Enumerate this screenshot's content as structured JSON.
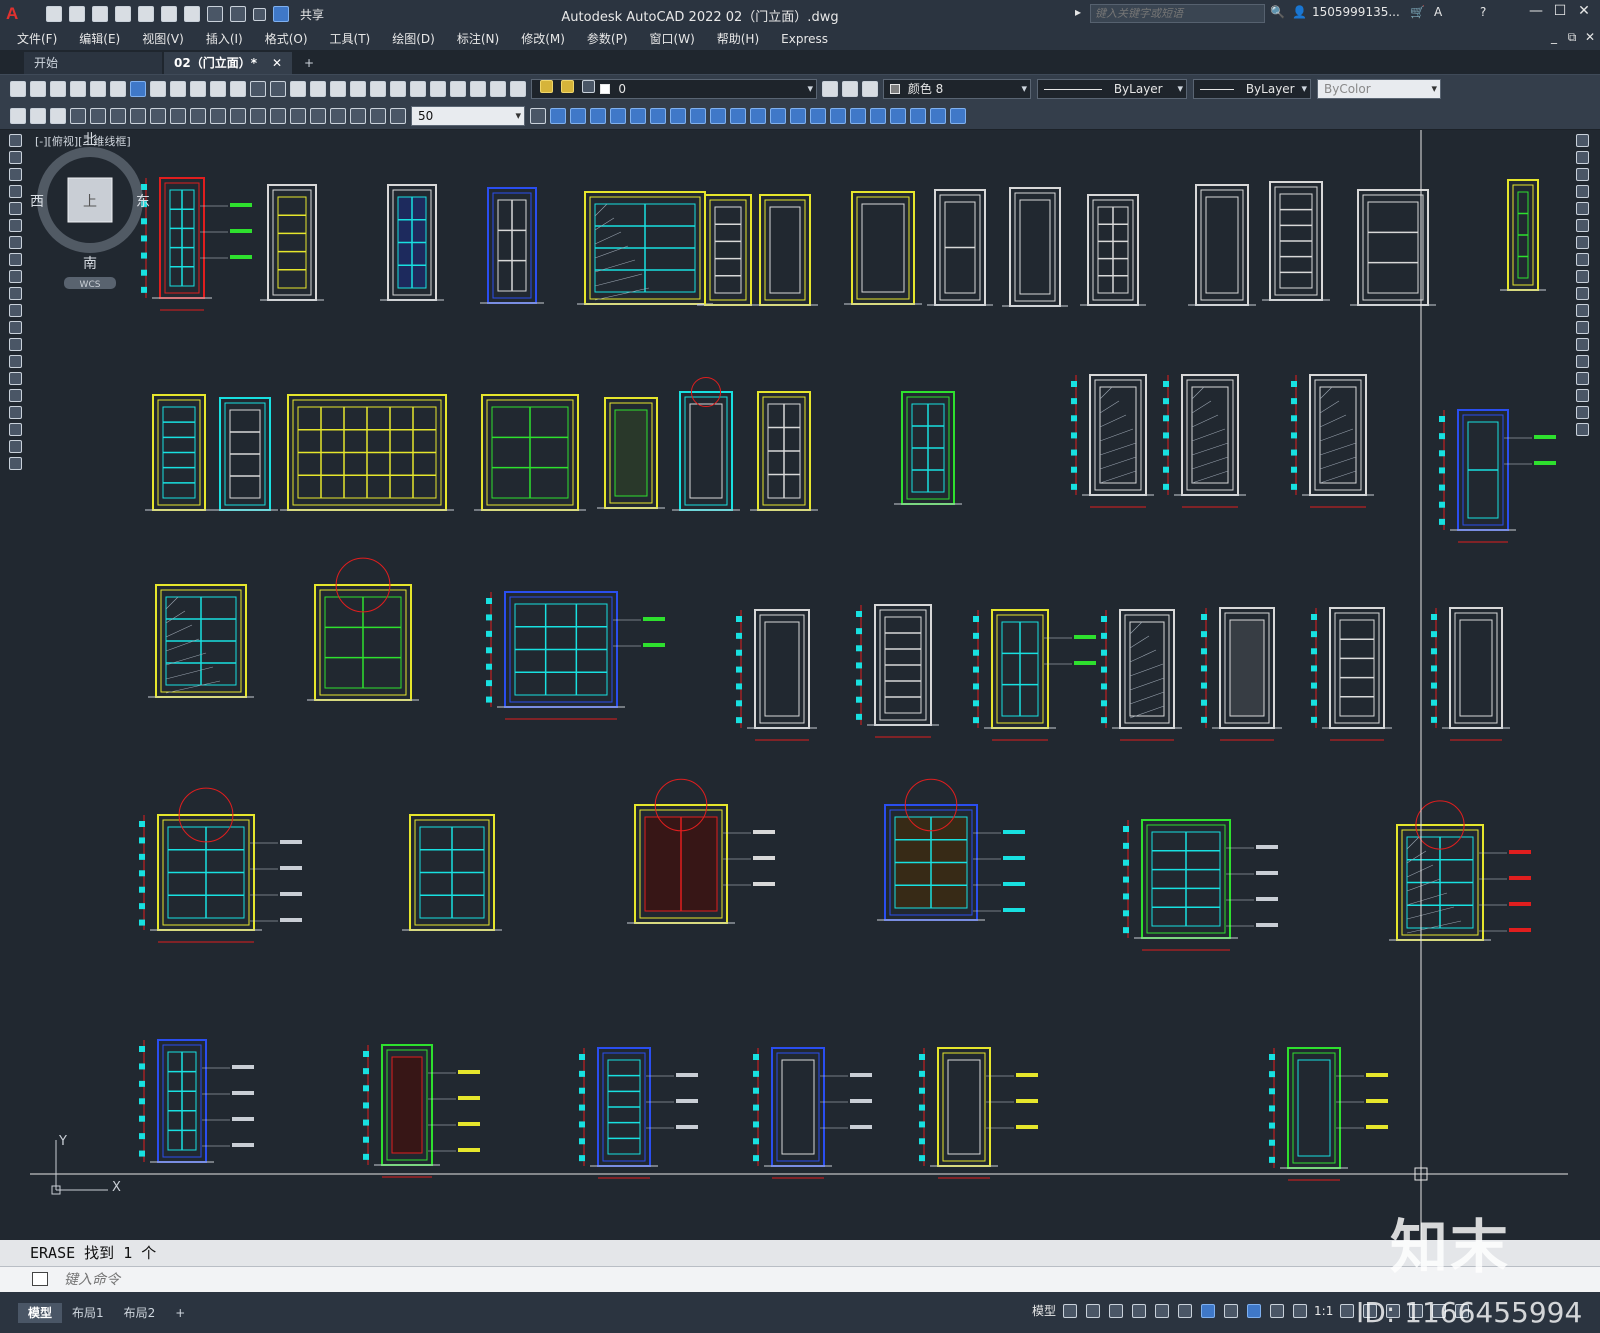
{
  "window": {
    "app_letter": "A",
    "title": "Autodesk AutoCAD 2022    02（门立面）.dwg",
    "share_label": "共享",
    "search_placeholder": "键入关键字或短语",
    "user": "1505999135...",
    "min": "—",
    "max": "☐",
    "close": "✕",
    "doc_min": "_",
    "doc_restore": "⧉",
    "doc_close": "✕"
  },
  "menu": [
    "文件(F)",
    "编辑(E)",
    "视图(V)",
    "插入(I)",
    "格式(O)",
    "工具(T)",
    "绘图(D)",
    "标注(N)",
    "修改(M)",
    "参数(P)",
    "窗口(W)",
    "帮助(H)",
    "Express"
  ],
  "tabs": {
    "start": "开始",
    "active": "02（门立面）*",
    "active_close": "✕",
    "add": "+"
  },
  "toolbar": {
    "layer": "0",
    "color": "颜色 8",
    "linetype": "ByLayer",
    "lineweight": "ByLayer",
    "plotstyle": "ByColor",
    "dimscale": "50"
  },
  "canvas": {
    "view_label": "[-][俯视][二维线框]",
    "viewcube": {
      "n": "北",
      "s": "南",
      "e": "东",
      "w": "西",
      "top": "上",
      "wcs": "WCS"
    },
    "ucs_y": "Y",
    "ucs_x": "X"
  },
  "command": {
    "history": "ERASE  找到  1  个",
    "placeholder": "键入命令"
  },
  "status": {
    "layout_tabs": [
      "模型",
      "布局1",
      "布局2"
    ],
    "add_layout": "+",
    "model_label": "模型",
    "scale": "1:1"
  },
  "watermark": {
    "brand": "知末",
    "id": "ID: 1166455994"
  },
  "colors": {
    "bg": "#212830",
    "yellow": "#e6e62c",
    "cyan": "#18e0e0",
    "green": "#2ee02e",
    "red": "#e01e1e",
    "blue": "#2a4ef0",
    "white": "#d8d8d8",
    "magenta": "#c832c8"
  }
}
